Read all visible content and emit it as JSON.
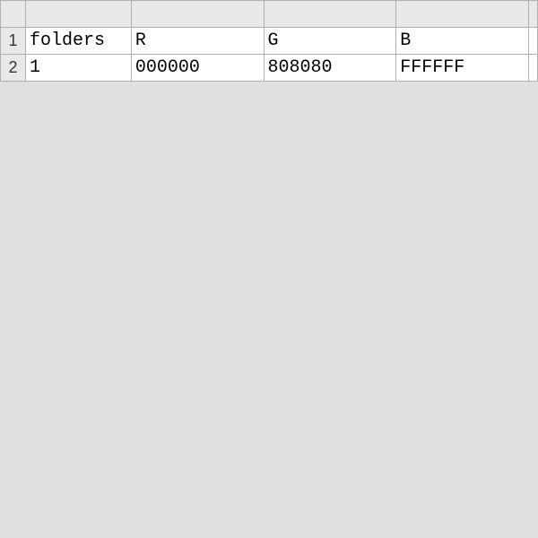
{
  "spreadsheet": {
    "columnHeaders": [
      "",
      "",
      "",
      "",
      ""
    ],
    "rowHeaders": [
      "1",
      "2"
    ],
    "rows": [
      {
        "cells": [
          "folders",
          "R",
          "G",
          "B",
          ""
        ]
      },
      {
        "cells": [
          "1",
          "000000",
          "808080",
          "FFFFFF",
          ""
        ]
      }
    ]
  }
}
